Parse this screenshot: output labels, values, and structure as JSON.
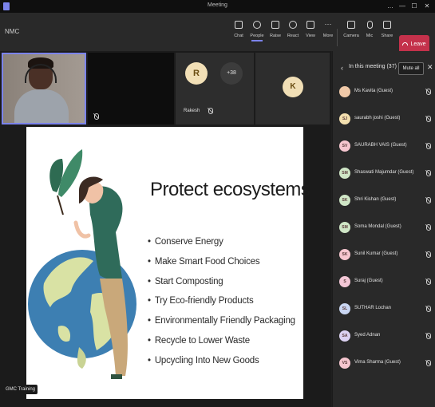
{
  "window": {
    "title": "Meeting",
    "controls": [
      "…",
      "—",
      "☐",
      "✕"
    ]
  },
  "meeting_name": "NMC",
  "toolbar": {
    "buttons": [
      {
        "label": "Chat",
        "icon": "chat-icon"
      },
      {
        "label": "People",
        "icon": "people-icon"
      },
      {
        "label": "Raise",
        "icon": "raise-hand-icon"
      },
      {
        "label": "React",
        "icon": "react-icon"
      },
      {
        "label": "View",
        "icon": "view-icon"
      },
      {
        "label": "More",
        "icon": "more-icon"
      },
      {
        "label": "Camera",
        "icon": "camera-icon"
      },
      {
        "label": "Mic",
        "icon": "mic-icon"
      },
      {
        "label": "Share",
        "icon": "share-icon"
      }
    ],
    "leave_label": "Leave"
  },
  "tiles": {
    "r_initial": "R",
    "r_name": "Rakesh",
    "more_count": "+38",
    "k_initial": "K"
  },
  "slide": {
    "title": "Protect ecosystems",
    "bullets": [
      "Conserve Energy",
      "Make Smart Food Choices",
      "Start Composting",
      "Try Eco-friendly Products",
      "Environmentally Friendly Packaging",
      "Recycle to Lower Waste",
      "Upcycling Into New Goods"
    ]
  },
  "presenter_label": "GMC Training",
  "panel": {
    "title": "In this meeting (37)",
    "mute_all": "Mute all",
    "participants": [
      {
        "initials": "",
        "name": "Ms Kavita (Guest)",
        "color": "#f0c9a8"
      },
      {
        "initials": "SJ",
        "name": "saurabh joshi (Guest)",
        "color": "#f3dfae"
      },
      {
        "initials": "SV",
        "name": "SAURABH VAIS (Guest)",
        "color": "#f6c6cf"
      },
      {
        "initials": "SM",
        "name": "Shaswati Majumdar (Guest)",
        "color": "#cfe6c6"
      },
      {
        "initials": "SK",
        "name": "Shri Kishan (Guest)",
        "color": "#cfe6c6"
      },
      {
        "initials": "SM",
        "name": "Soma Mondal (Guest)",
        "color": "#cfe6c6"
      },
      {
        "initials": "SK",
        "name": "Sunil Kumar (Guest)",
        "color": "#f6c6cf"
      },
      {
        "initials": "S",
        "name": "Suraj (Guest)",
        "color": "#f3c7d6"
      },
      {
        "initials": "SL",
        "name": "SUTHAR Lochan",
        "color": "#c9d6f2"
      },
      {
        "initials": "SA",
        "name": "Syed Adnan",
        "color": "#dcd2f2"
      },
      {
        "initials": "VS",
        "name": "Vima Sharma (Guest)",
        "color": "#f6c6cf"
      }
    ]
  },
  "colors": {
    "accent": "#7b83eb",
    "leave": "#c4314b",
    "panel_bg": "#292929",
    "toolbar_bg": "#292929"
  }
}
